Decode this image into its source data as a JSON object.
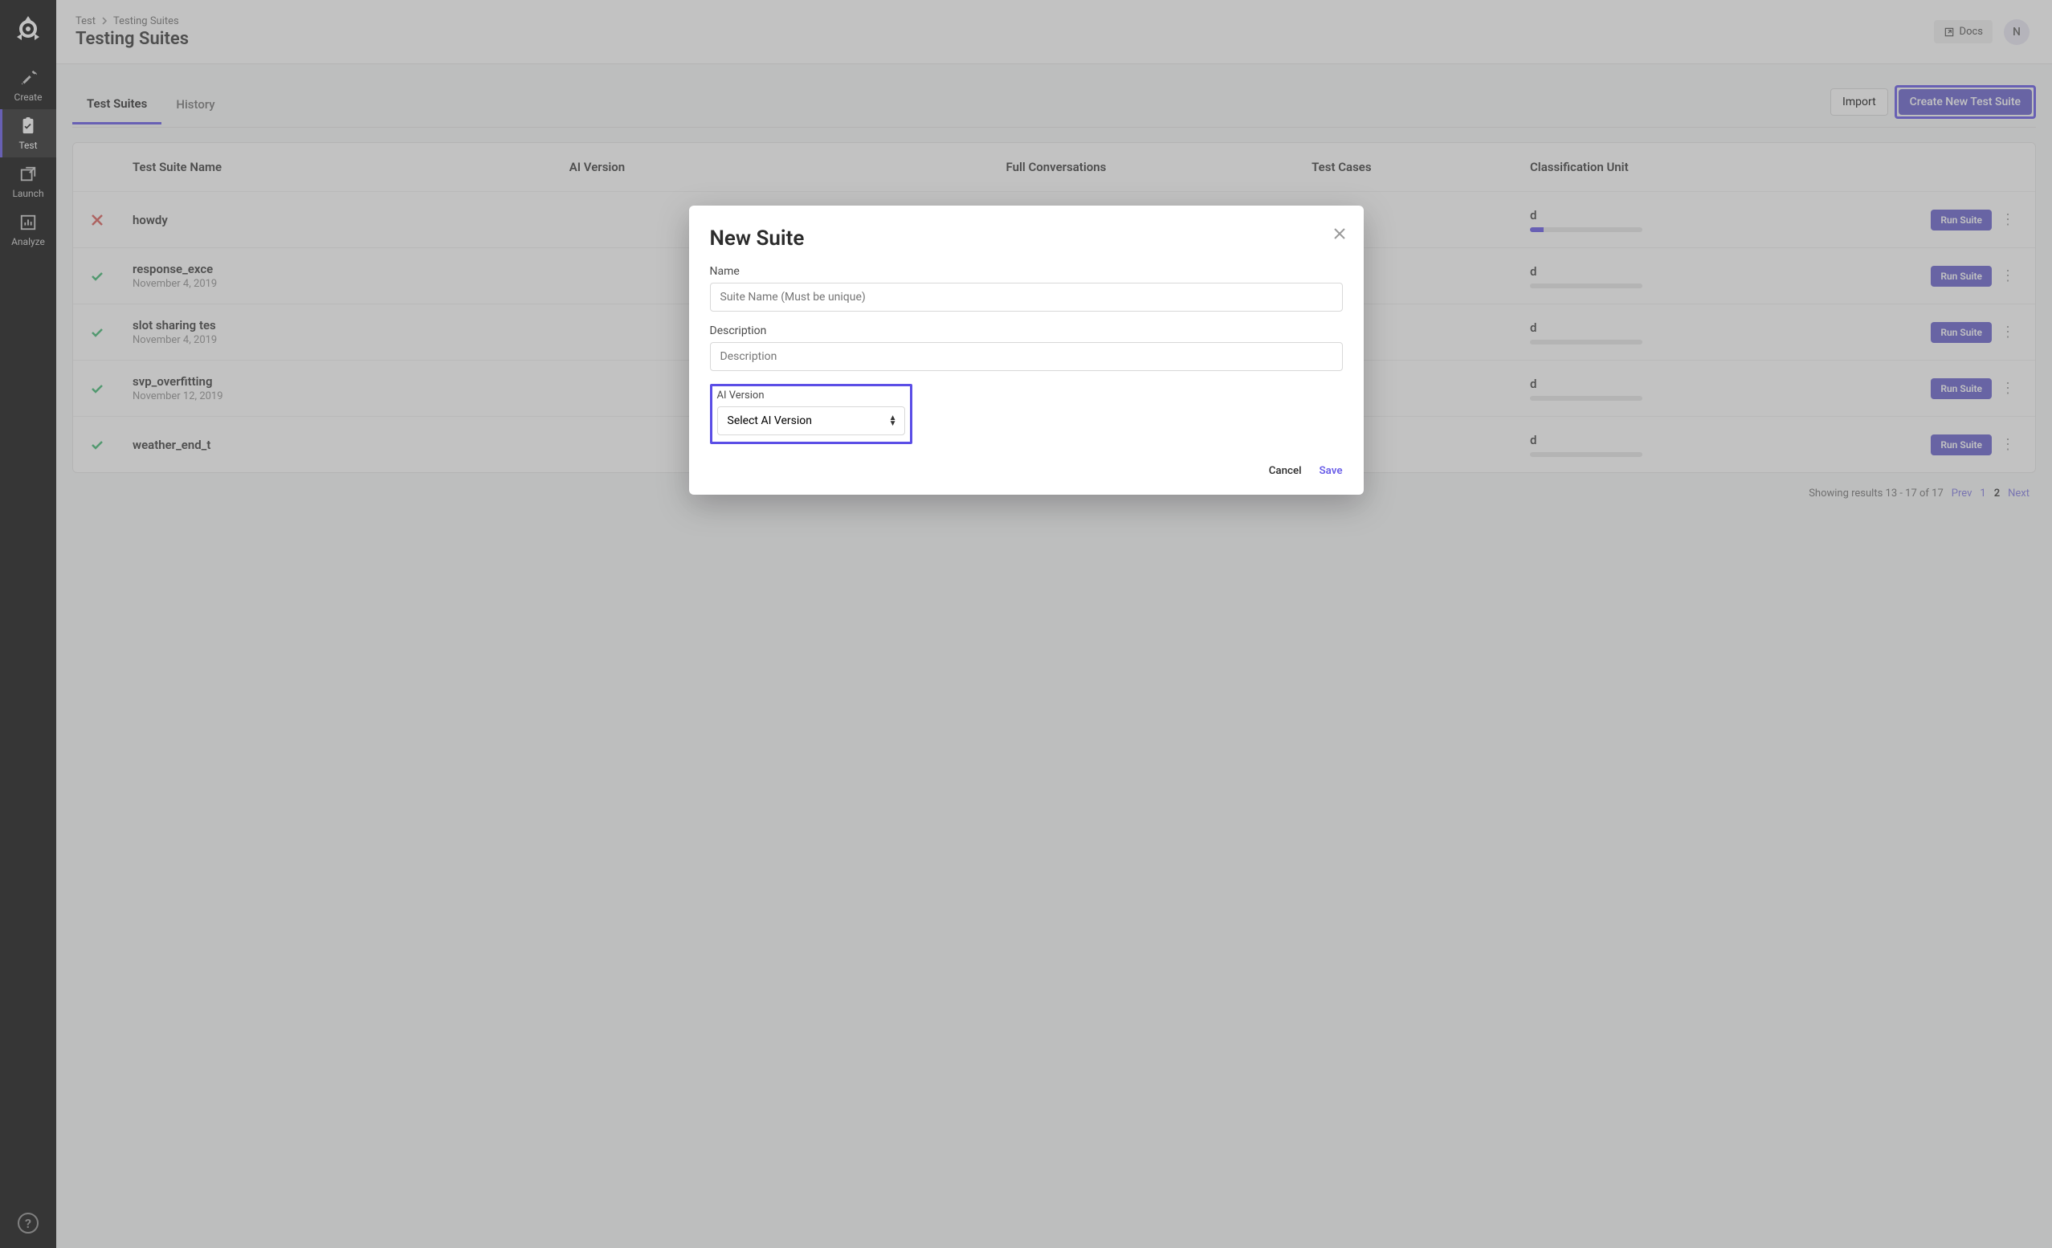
{
  "sidebar": {
    "items": [
      {
        "label": "Create"
      },
      {
        "label": "Test"
      },
      {
        "label": "Launch"
      },
      {
        "label": "Analyze"
      }
    ],
    "help": "?"
  },
  "breadcrumb": {
    "root": "Test",
    "current": "Testing Suites"
  },
  "page": {
    "title": "Testing Suites"
  },
  "topbar": {
    "docs": "Docs",
    "avatar": "N"
  },
  "tabs": {
    "items": [
      {
        "label": "Test Suites"
      },
      {
        "label": "History"
      }
    ],
    "import": "Import",
    "create": "Create New Test Suite"
  },
  "table": {
    "headers": {
      "name": "Test Suite Name",
      "ai": "AI Version",
      "conv": "Full Conversations",
      "cases": "Test Cases",
      "unit": "Classification Unit"
    },
    "rows": [
      {
        "status": "fail",
        "name": "howdy",
        "date": "",
        "unit_suffix": "d",
        "progress": 12,
        "action": "Run Suite"
      },
      {
        "status": "pass",
        "name": "response_exce",
        "date": "November 4, 2019",
        "unit_suffix": "d",
        "progress": 0,
        "action": "Run Suite"
      },
      {
        "status": "pass",
        "name": "slot sharing tes",
        "date": "November 4, 2019",
        "unit_suffix": "d",
        "progress": 0,
        "action": "Run Suite"
      },
      {
        "status": "pass",
        "name": "svp_overfitting",
        "date": "November 12, 2019",
        "unit_suffix": "d",
        "progress": 0,
        "action": "Run Suite"
      },
      {
        "status": "pass",
        "name": "weather_end_t",
        "date": "",
        "unit_suffix": "d",
        "progress": 0,
        "action": "Run Suite"
      }
    ]
  },
  "pager": {
    "summary": "Showing results 13 - 17 of 17",
    "prev": "Prev",
    "p1": "1",
    "p2": "2",
    "next": "Next"
  },
  "modal": {
    "title": "New Suite",
    "name_label": "Name",
    "name_placeholder": "Suite Name (Must be unique)",
    "desc_label": "Description",
    "desc_placeholder": "Description",
    "ai_label": "AI Version",
    "ai_placeholder": "Select AI Version",
    "cancel": "Cancel",
    "save": "Save"
  }
}
